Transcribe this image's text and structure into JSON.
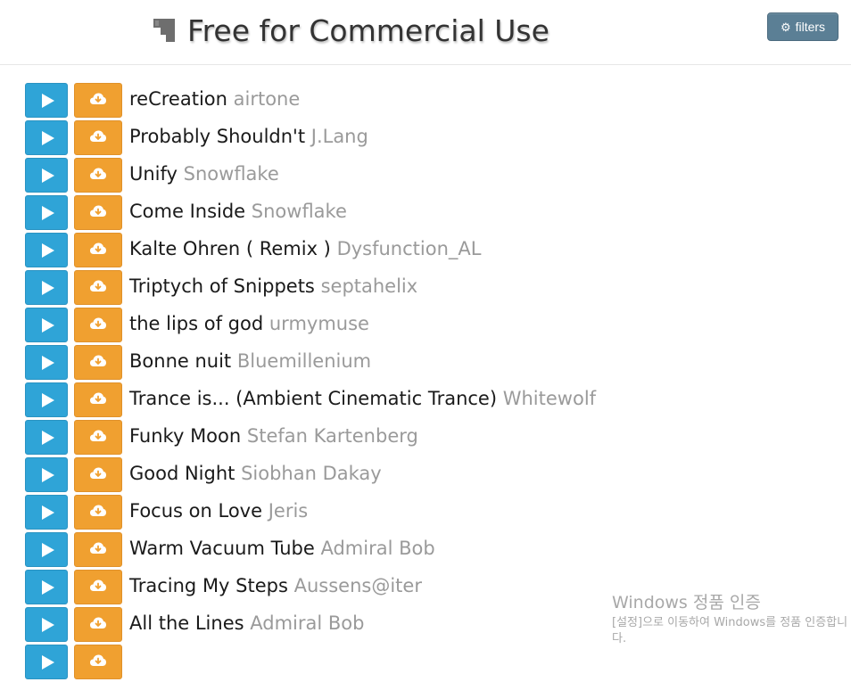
{
  "header": {
    "title": "Free for Commercial Use",
    "filters_label": "filters",
    "logo_icon": "plug-logo-icon",
    "filters_icon": "gear-icon"
  },
  "colors": {
    "play_button": "#2fa4d7",
    "download_button": "#f0a030",
    "filters_button": "#5b7f95",
    "artist_text": "#9a9a9a"
  },
  "tracks": [
    {
      "title": "reCreation",
      "artist": "airtone"
    },
    {
      "title": "Probably Shouldn't",
      "artist": "J.Lang"
    },
    {
      "title": "Unify",
      "artist": "Snowflake"
    },
    {
      "title": "Come Inside",
      "artist": "Snowflake"
    },
    {
      "title": "Kalte Ohren ( Remix )",
      "artist": "Dysfunction_AL"
    },
    {
      "title": "Triptych of Snippets",
      "artist": "septahelix"
    },
    {
      "title": "the lips of god",
      "artist": "urmymuse"
    },
    {
      "title": "Bonne nuit",
      "artist": "Bluemillenium"
    },
    {
      "title": "Trance is... (Ambient Cinematic Trance)",
      "artist": "Whitewolf"
    },
    {
      "title": "Funky Moon",
      "artist": "Stefan Kartenberg"
    },
    {
      "title": "Good Night",
      "artist": "Siobhan Dakay"
    },
    {
      "title": "Focus on Love",
      "artist": "Jeris"
    },
    {
      "title": "Warm Vacuum Tube",
      "artist": "Admiral Bob"
    },
    {
      "title": "Tracing My Steps",
      "artist": "Aussens@iter"
    },
    {
      "title": "All the Lines",
      "artist": "Admiral Bob"
    },
    {
      "title": "",
      "artist": ""
    }
  ],
  "watermark": {
    "title": "Windows 정품 인증",
    "subtitle": "[설정]으로 이동하여 Windows를 정품 인증합니다."
  }
}
